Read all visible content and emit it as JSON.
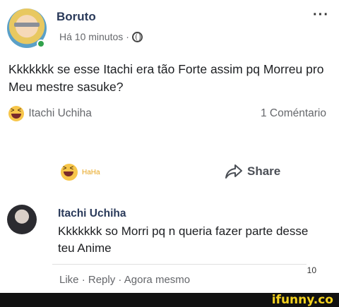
{
  "post": {
    "author": "Boruto",
    "time": "Há 10 minutos",
    "separator": "·",
    "more": "···",
    "text": "Kkkkkkk se esse Itachi era tão Forte assim pq Morreu pro Meu mestre sasuke?"
  },
  "reactions": {
    "reactor_name": "Itachi Uchiha",
    "comment_count": "1 Coméntario"
  },
  "actions": {
    "haha_label": "HaHa",
    "share_label": "Share"
  },
  "comment": {
    "author": "Itachi Uchiha",
    "text": "Kkkkkkk so Morri pq n queria fazer parte desse teu Anime",
    "reaction_count": "10",
    "like_label": "Like",
    "reply_label": "Reply",
    "time": "Agora mesmo",
    "dot": "·"
  },
  "watermark": "ifunny.co",
  "colors": {
    "author": "#2a3a5a",
    "online": "#31a24c",
    "haha": "#f7c64a",
    "muted": "#65676b",
    "watermark": "#f5d21e"
  },
  "icons": [
    "more-icon",
    "globe-icon",
    "haha-emoji-icon",
    "share-icon",
    "online-dot"
  ]
}
